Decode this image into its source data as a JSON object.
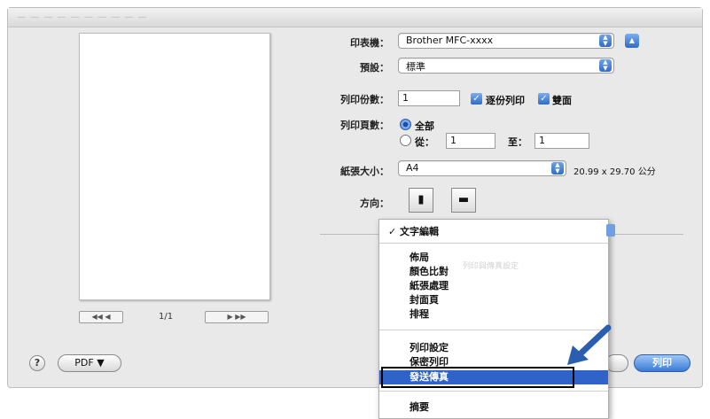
{
  "titlebar_text": "— — — — — — — — — —",
  "preview": {
    "first_label": "◀◀ ◀",
    "next_label": "▶ ▶▶",
    "page_count": "1/1"
  },
  "form": {
    "printer_label": "印表機：",
    "printer_value": "Brother MFC-xxxx",
    "preset_label": "預設：",
    "preset_value": "標準",
    "copies_label": "列印份數：",
    "copies_value": "1",
    "collate_label": "逐份列印",
    "duplex_label": "雙面",
    "pages_label": "列印頁數：",
    "all_label": "全部",
    "from_label": "從：",
    "from_value": "1",
    "to_label": "至：",
    "to_value": "1",
    "paper_label": "紙張大小：",
    "paper_value": "A4",
    "paper_dims": "20.99 x 29.70 公分",
    "orientation_label": "方向："
  },
  "menu": {
    "checked": "✓ 文字編輯",
    "ghost_text": "列印與傳真設定",
    "items_a": [
      "佈局",
      "顏色比對",
      "紙張處理",
      "封面頁",
      "排程"
    ],
    "items_b": [
      "列印設定",
      "保密列印"
    ],
    "selected": "發送傳真",
    "items_c": [
      "摘要"
    ]
  },
  "bottom": {
    "help": "?",
    "pdf": "PDF ▼",
    "print": "列印"
  },
  "colors": {
    "accent": "#2f63c8",
    "highlight_border": "#000000",
    "arrow": "#2a5fb0"
  }
}
